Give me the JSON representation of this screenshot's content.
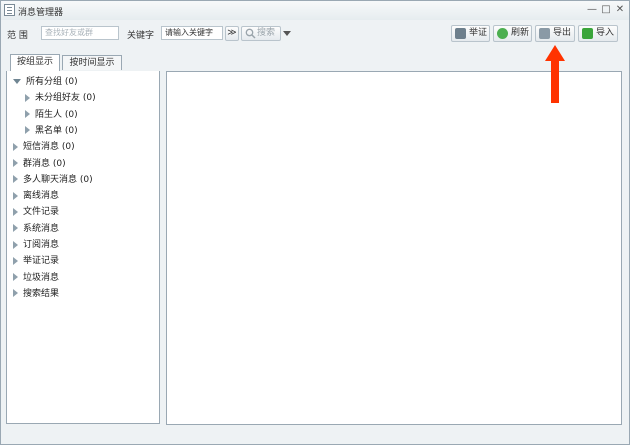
{
  "window": {
    "title": "消息管理器",
    "controls": [
      "—",
      "□",
      "✕"
    ]
  },
  "toolbar": {
    "range_label": "范 围",
    "range_placeholder": "查找好友或群",
    "keyword_label": "关键字",
    "keyword_value": "请输入关键字",
    "more_glyph": "≫",
    "search_label": "搜索",
    "buttons": [
      {
        "label": "举证",
        "icon": "evidence-icon",
        "color": "#6d7f8c"
      },
      {
        "label": "刷新",
        "icon": "refresh-icon",
        "color": "#4caf50"
      },
      {
        "label": "导出",
        "icon": "export-icon",
        "color": "#8a9aa6"
      },
      {
        "label": "导入",
        "icon": "import-icon",
        "color": "#3aa53a"
      }
    ]
  },
  "tabs": [
    {
      "label": "按组显示",
      "active": true
    },
    {
      "label": "按时间显示",
      "active": false
    }
  ],
  "tree": [
    {
      "label": "所有分组 (0)",
      "expanded": true,
      "level": 0
    },
    {
      "label": "未分组好友 (0)",
      "expanded": false,
      "level": 1
    },
    {
      "label": "陌生人 (0)",
      "expanded": false,
      "level": 1
    },
    {
      "label": "黑名单 (0)",
      "expanded": false,
      "level": 1
    },
    {
      "label": "短信消息 (0)",
      "expanded": false,
      "level": 0
    },
    {
      "label": "群消息 (0)",
      "expanded": false,
      "level": 0
    },
    {
      "label": "多人聊天消息 (0)",
      "expanded": false,
      "level": 0
    },
    {
      "label": "离线消息",
      "expanded": false,
      "level": 0
    },
    {
      "label": "文件记录",
      "expanded": false,
      "level": 0
    },
    {
      "label": "系统消息",
      "expanded": false,
      "level": 0
    },
    {
      "label": "订阅消息",
      "expanded": false,
      "level": 0
    },
    {
      "label": "举证记录",
      "expanded": false,
      "level": 0
    },
    {
      "label": "垃圾消息",
      "expanded": false,
      "level": 0
    },
    {
      "label": "搜索结果",
      "expanded": false,
      "level": 0
    }
  ],
  "annotation": {
    "color": "#ff3300"
  }
}
